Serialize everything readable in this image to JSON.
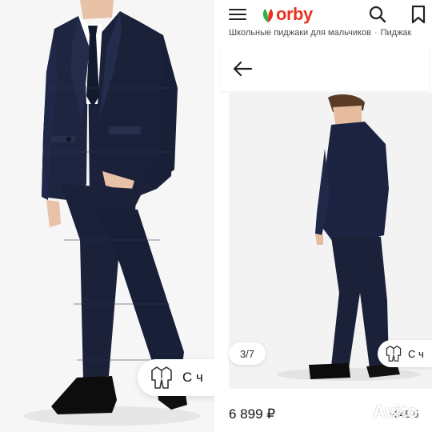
{
  "left_panel": {
    "photo": "boy in navy checked school suit, white shirt, navy tie, black shoes",
    "fitting_chip": {
      "icon": "suit-icon",
      "label": "С ч"
    }
  },
  "header": {
    "logo_text": "orby",
    "logo_color": "#e8331e",
    "icons": [
      "menu-icon",
      "search-icon",
      "bookmark-icon"
    ]
  },
  "breadcrumb": [
    "Школьные пиджаки для мальчиков",
    "Пиджак"
  ],
  "gallery": {
    "back_icon": "arrow-left-icon",
    "counter": "3/7",
    "fitting_chip": {
      "icon": "suit-icon",
      "label": "С ч"
    }
  },
  "product": {
    "price": "6 899 ₽",
    "bonus": "+345 б"
  },
  "watermark": {
    "text": "Avito"
  }
}
